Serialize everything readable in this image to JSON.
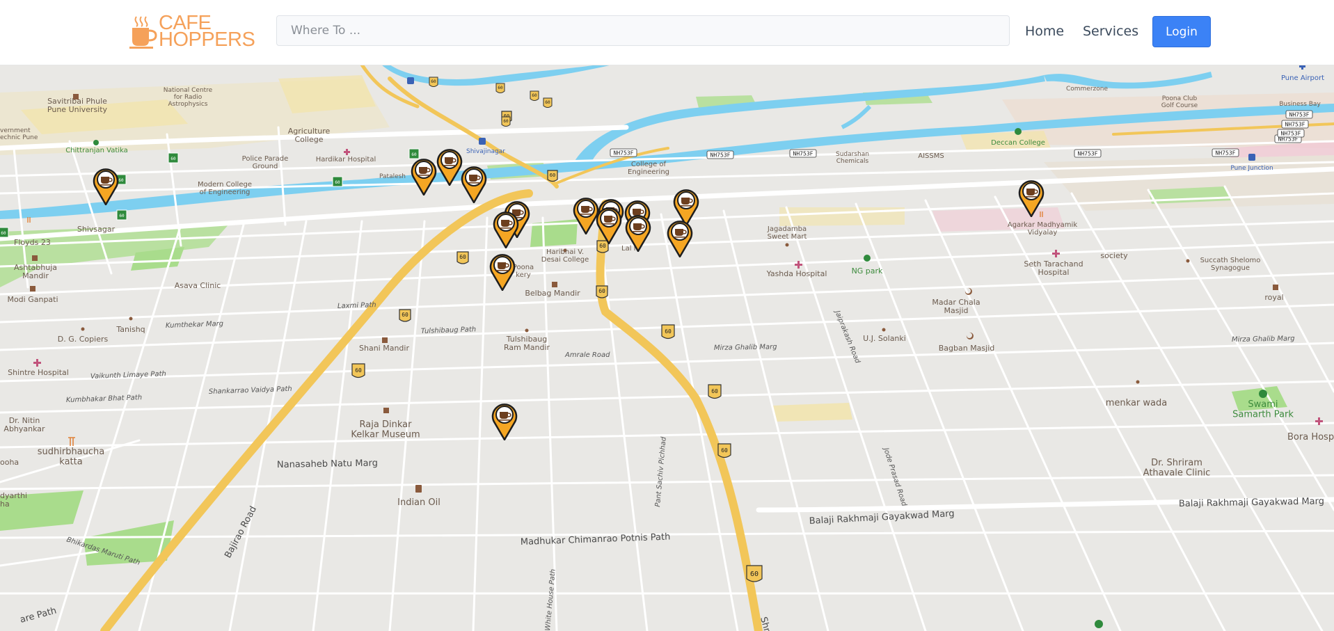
{
  "header": {
    "logo_line1": "CAFE",
    "logo_line2": "HOPPERS",
    "logo_icon": "coffee-cup-icon",
    "search_placeholder": "Where To ...",
    "nav": {
      "home": "Home",
      "services": "Services",
      "login": "Login"
    }
  },
  "colors": {
    "brand": "#f5a15a",
    "login_button": "#3b82f6",
    "map_background": "#e9e8e5",
    "river": "#7dcff0",
    "highway": "#f2c659",
    "park": "#a9dc8c",
    "marker_fill": "#f5a623"
  },
  "map": {
    "marker_icon": "coffee-marker-icon",
    "marker_count": 19,
    "places": [
      "Savitribai Phule\nPune University",
      "National Centre\nfor Radio\nAstrophysics",
      "Agriculture\nCollege",
      "Hardikar Hospital",
      "Police Parade\nGround",
      "Chittranjan Vatika",
      "Modern College\nof Engineering",
      "Shivsagar",
      "Floyds 23",
      "Ashtabhuja\nMandir",
      "Asava Clinic",
      "Modi Ganpati",
      "Tanishq",
      "D. G. Copiers",
      "Shintre Hospital",
      "Dr. Nitin\nAbhyankar",
      "sudhirbhaucha\nkatta",
      "ooha",
      "dyarthi\nha",
      "vernment\nechnic Pune",
      "Patalesh",
      "Shivajinagar",
      "College of\nEngineering",
      "Haribhai V.\nDesai College",
      "Poona\nkery",
      "Belbag Mandir",
      "Lal M",
      "Tulshibaug\nRam Mandir",
      "Shani Mandir",
      "Raja Dinkar\nKelkar Museum",
      "Indian Oil",
      "Jagadamba\nSweet Mart",
      "Yashda Hospital",
      "NG park",
      "Madar Chala\nMasjid",
      "U.J. Solanki",
      "Bagban Masjid",
      "Sudarshan\nChemicals",
      "AISSMS",
      "Deccan College",
      "Commerzone",
      "Poona Club\nGolf Course",
      "Business Bay",
      "Pune Airport",
      "Pune Junction",
      "Agarkar Madhyamik\nVidyalay",
      "Seth Tarachand\nHospital",
      "society",
      "Succath Shelomo\nSynagogue",
      "royal",
      "menkar wada",
      "Swami\nSamarth Park",
      "Bora Hospi",
      "Dr. Shriram\nAthavale Clinic"
    ],
    "roads": [
      "Bajirao Road",
      "Nanasaheb Natu Marg",
      "Madhukar Chimanrao Potnis Path",
      "Balaji Rakhmaji Gayakwad Marg",
      "Balaji Rakhmaji Gayakwad Marg",
      "Shri",
      "Pant Sachiv Pichhad",
      "White House Path",
      "Bhikardas Maruti Path",
      "Kumbhakar Bhat Path",
      "Vaikunth Limaye Path",
      "Shankarrao Vaidya Path",
      "Amrale Road",
      "Laxmi Path",
      "Kumthekar Marg",
      "Tulshibaug Path",
      "Mirza Ghalib Marg",
      "Jaiprakash Road",
      "Jode Prasad Road",
      "Mirza Ghalib Marg",
      "are Path"
    ],
    "highway_shields": [
      "60",
      "60",
      "60",
      "60",
      "60",
      "60",
      "60",
      "60",
      "60",
      "60",
      "60",
      "60",
      "60",
      "60",
      "60",
      "60",
      "60",
      "60",
      "60",
      "60",
      "60",
      "60"
    ],
    "nh_shields": [
      "NH753F",
      "NH753F",
      "NH753F",
      "NH753F",
      "NH753F",
      "NH753F",
      "NH753F",
      "NH753F",
      "NH753F"
    ]
  }
}
